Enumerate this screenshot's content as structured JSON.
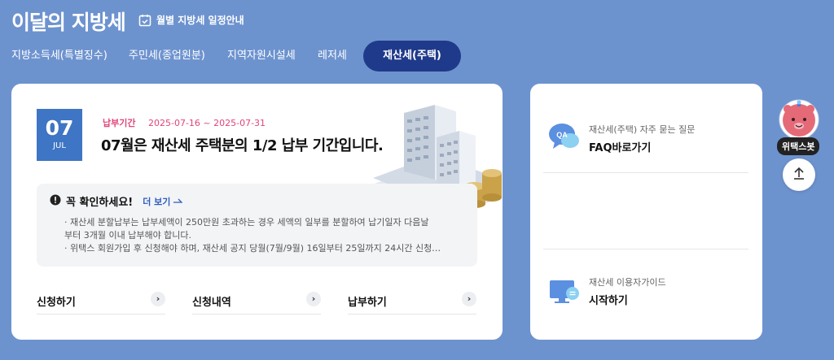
{
  "header": {
    "title": "이달의 지방세",
    "schedule_link": "월별 지방세 일정안내"
  },
  "tabs": [
    {
      "label": "지방소득세(특별징수)",
      "active": false
    },
    {
      "label": "주민세(종업원분)",
      "active": false
    },
    {
      "label": "지역자원시설세",
      "active": false
    },
    {
      "label": "레저세",
      "active": false
    },
    {
      "label": "재산세(주택)",
      "active": true
    }
  ],
  "main": {
    "date": {
      "day": "07",
      "month": "JUL"
    },
    "period_label": "납부기간",
    "period_value": "2025-07-16 ~ 2025-07-31",
    "headline": "07월은 재산세 주택분의 1/2 납부 기간입니다.",
    "notice": {
      "title": "꼭 확인하세요!",
      "more": "더 보기",
      "lines": [
        "· 재산세 분할납부는 납부세액이 250만원 초과하는 경우 세액의 일부를 분할하여 납기일자 다음날",
        "부터 3개월 이내 납부해야 합니다.",
        "· 위택스 회원가입 후 신청해야 하며, 재산세 공지 당월(7월/9월) 16일부터 25일까지 24시간 신청…"
      ]
    },
    "actions": [
      {
        "label": "신청하기"
      },
      {
        "label": "신청내역"
      },
      {
        "label": "납부하기"
      }
    ]
  },
  "side": {
    "faq": {
      "small": "재산세(주택) 자주 묻는 질문",
      "big": "FAQ바로가기",
      "icon_text": "QA"
    },
    "guide": {
      "small": "재산세 이용자가이드",
      "big": "시작하기"
    }
  },
  "chatbot": {
    "label": "위택스봇"
  },
  "colors": {
    "background": "#6d93cf",
    "active_tab": "#1f3a8a",
    "date_box": "#3e75c4",
    "period": "#e0457b",
    "link": "#2e5bbd"
  },
  "icons": [
    "calendar-check-icon",
    "building-illustration",
    "alert-icon",
    "arrow-right-icon",
    "chevron-right-icon",
    "qa-icon",
    "monitor-icon",
    "chatbot-avatar",
    "arrow-up-icon"
  ]
}
